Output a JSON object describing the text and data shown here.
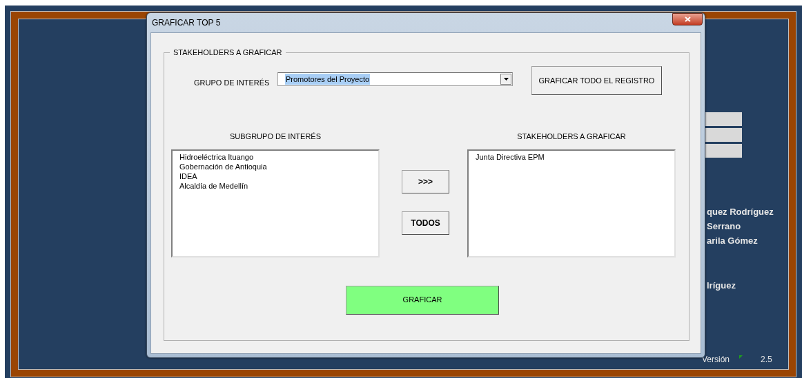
{
  "sheet": {
    "names": [
      "quez Rodríguez",
      "Serrano",
      "arila Gómez"
    ],
    "name_extra": "lríguez",
    "version_label": "Versión",
    "version": "2.5"
  },
  "window": {
    "title": "GRAFICAR TOP 5"
  },
  "group_box": {
    "title": "STAKEHOLDERS A GRAFICAR"
  },
  "interest_group": {
    "label": "GRUPO DE INTERÉS",
    "value": "Promotores del Proyecto"
  },
  "graph_all_button": "GRAFICAR TODO EL REGISTRO",
  "subgroups": {
    "title": "SUBGRUPO DE INTERÉS",
    "items": [
      "Hidroeléctrica Ituango",
      "Gobernación de Antioquia",
      "IDEA",
      "Alcaldía de Medellín"
    ]
  },
  "move_buttons": [
    ">>>",
    "TODOS"
  ],
  "selected_stakeholders": {
    "title": "STAKEHOLDERS A GRAFICAR",
    "items": [
      "Junta Directiva EPM"
    ]
  },
  "graph_button": "GRAFICAR"
}
